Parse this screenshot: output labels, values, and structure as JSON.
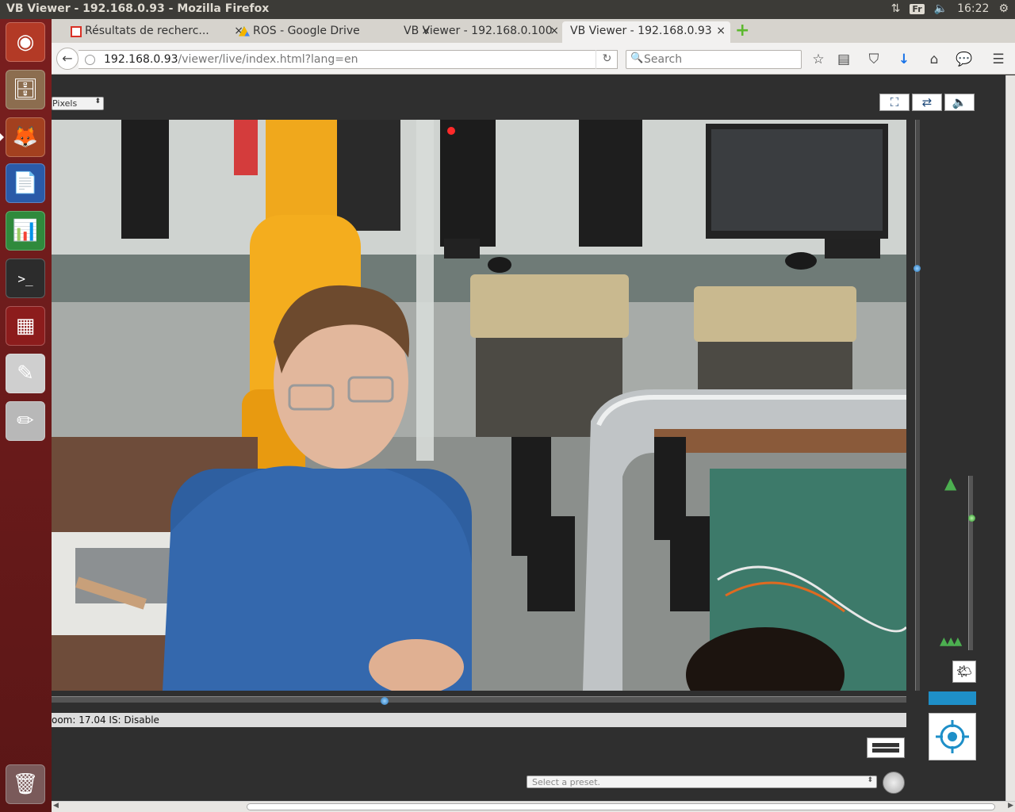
{
  "system": {
    "window_title": "VB Viewer - 192.168.0.93 - Mozilla Firefox",
    "keyboard_layout": "Fr",
    "clock": "16:22"
  },
  "launcher": {
    "items": [
      {
        "name": "ubuntu-dash",
        "glyph": "◉",
        "bg": "#b33a26"
      },
      {
        "name": "files",
        "glyph": "🗄",
        "bg": "#8c6d4f"
      },
      {
        "name": "firefox",
        "glyph": "🦊",
        "bg": "#a3401f"
      },
      {
        "name": "writer",
        "glyph": "📄",
        "bg": "#2a5aa8"
      },
      {
        "name": "calc",
        "glyph": "📊",
        "bg": "#2f8a3c"
      },
      {
        "name": "terminal",
        "glyph": ">_",
        "bg": "#2c2c2c"
      },
      {
        "name": "remote-desktop",
        "glyph": "▦",
        "bg": "#8c1c1c"
      },
      {
        "name": "pdf-viewer",
        "glyph": "✎",
        "bg": "#cfcfcf"
      },
      {
        "name": "text-editor",
        "glyph": "✏",
        "bg": "#b8b8b8"
      },
      {
        "name": "trash",
        "glyph": "🗑",
        "bg": "#7a5a5a"
      }
    ]
  },
  "tabs": [
    {
      "label": "Résultats de recherc...",
      "icon_color": "#d93025",
      "close": "×"
    },
    {
      "label": "ROS - Google Drive",
      "icon_color": "#f4b400",
      "close": "×"
    },
    {
      "label": "VB Viewer - 192.168.0.100",
      "icon_color": "",
      "close": "×"
    },
    {
      "label": "VB Viewer - 192.168.0.93",
      "icon_color": "",
      "close": "×"
    }
  ],
  "new_tab": "+",
  "nav": {
    "back": "←",
    "url_host": "192.168.0.93",
    "url_path": "/viewer/live/index.html?lang=en",
    "reload": "↻",
    "search_placeholder": "Search",
    "search_icon": "🔍",
    "icons": {
      "bookmark": "☆",
      "reading_list": "▤",
      "pocket": "⛉",
      "download": "↓",
      "home": "⌂",
      "chat": "💬",
      "menu": "☰"
    }
  },
  "viewer": {
    "units_selected": "Pixels",
    "select_arrows": "⬍",
    "fullscreen_icon": "⛶",
    "swap_icon": "⇄",
    "audio_icon": "🔈",
    "status": "oom: 17.04 IS: Disable",
    "preset_placeholder": "Select a preset.",
    "tree_tele": "▲",
    "tree_wide": "▲▲▲",
    "backlight_icon": "🌤",
    "zoom_position": 0.24,
    "pan_position": 0.39,
    "tilt_position": 0.26,
    "colors": {
      "accent": "#1e8fc8",
      "zoom_green": "#2e9e2e"
    }
  }
}
